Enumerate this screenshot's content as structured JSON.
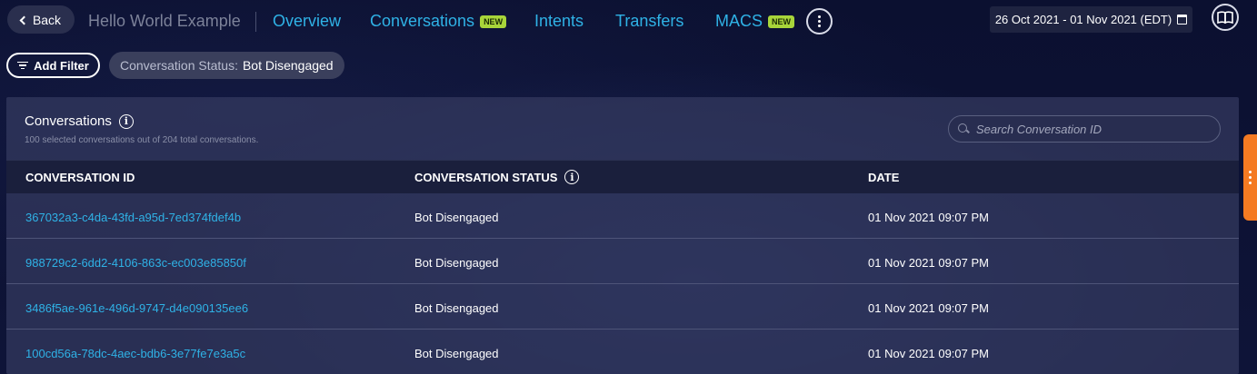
{
  "header": {
    "back_label": "Back",
    "app_title": "Hello World Example",
    "nav": [
      {
        "label": "Overview",
        "badge": ""
      },
      {
        "label": "Conversations",
        "badge": "NEW"
      },
      {
        "label": "Intents",
        "badge": ""
      },
      {
        "label": "Transfers",
        "badge": ""
      },
      {
        "label": "MACS",
        "badge": "NEW"
      }
    ],
    "date_range": "26 Oct 2021 - 01 Nov 2021 (EDT)"
  },
  "filters": {
    "add_filter_label": "Add Filter",
    "chip_key": "Conversation Status:",
    "chip_value": "Bot Disengaged"
  },
  "panel": {
    "title": "Conversations",
    "subtitle": "100 selected conversations out of 204 total conversations.",
    "search_placeholder": "Search Conversation ID",
    "columns": [
      "CONVERSATION ID",
      "CONVERSATION STATUS",
      "DATE"
    ],
    "rows": [
      {
        "id": "367032a3-c4da-43fd-a95d-7ed374fdef4b",
        "status": "Bot Disengaged",
        "date": "01 Nov 2021 09:07 PM"
      },
      {
        "id": "988729c2-6dd2-4106-863c-ec003e85850f",
        "status": "Bot Disengaged",
        "date": "01 Nov 2021 09:07 PM"
      },
      {
        "id": "3486f5ae-961e-496d-9747-d4e090135ee6",
        "status": "Bot Disengaged",
        "date": "01 Nov 2021 09:07 PM"
      },
      {
        "id": "100cd56a-78dc-4aec-bdb6-3e77fe7e3a5c",
        "status": "Bot Disengaged",
        "date": "01 Nov 2021 09:07 PM"
      }
    ]
  },
  "colors": {
    "accent_link": "#2fb2e6",
    "new_badge": "#a8d53a",
    "side_tab": "#f47a22"
  }
}
